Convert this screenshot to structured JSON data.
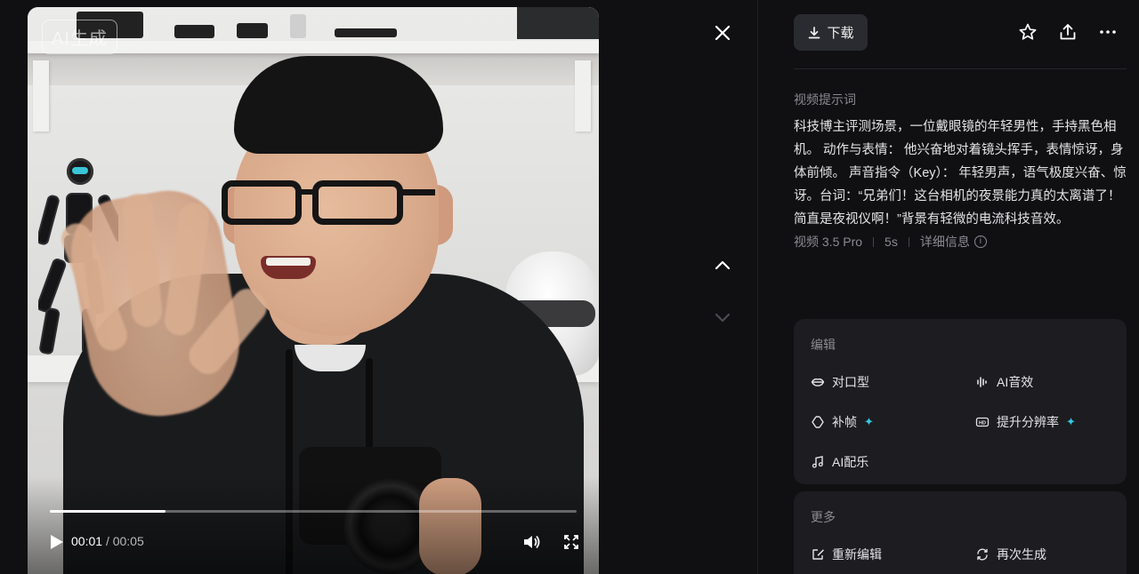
{
  "video": {
    "watermark": "AI生成",
    "current_time": "00:01",
    "total_time": "/ 00:05",
    "progress": 0.22
  },
  "toolbar": {
    "download_label": "下载",
    "star_icon": "star-icon",
    "share_icon": "share-icon",
    "more_icon": "more-icon"
  },
  "prompt_section": {
    "title": "视频提示词",
    "text": "科技博主评测场景，一位戴眼镜的年轻男性，手持黑色相机。 动作与表情： 他兴奋地对着镜头挥手，表情惊讶，身体前倾。 声音指令（Key）： 年轻男声，语气极度兴奋、惊讶。台词：“兄弟们！这台相机的夜景能力真的太离谱了！简直是夜视仪啊！”背景有轻微的电流科技音效。",
    "model": "视频 3.5 Pro",
    "duration": "5s",
    "details": "详细信息"
  },
  "edit_section": {
    "title": "编辑",
    "tools": [
      "对口型",
      "AI音效",
      "补帧",
      "提升分辨率",
      "AI配乐"
    ]
  },
  "more_section": {
    "title": "更多",
    "tools": [
      "重新编辑",
      "再次生成"
    ]
  },
  "colors": {
    "background": "#101013",
    "card": "#1d1d21",
    "accent_sparkle": "#35c8e6"
  }
}
